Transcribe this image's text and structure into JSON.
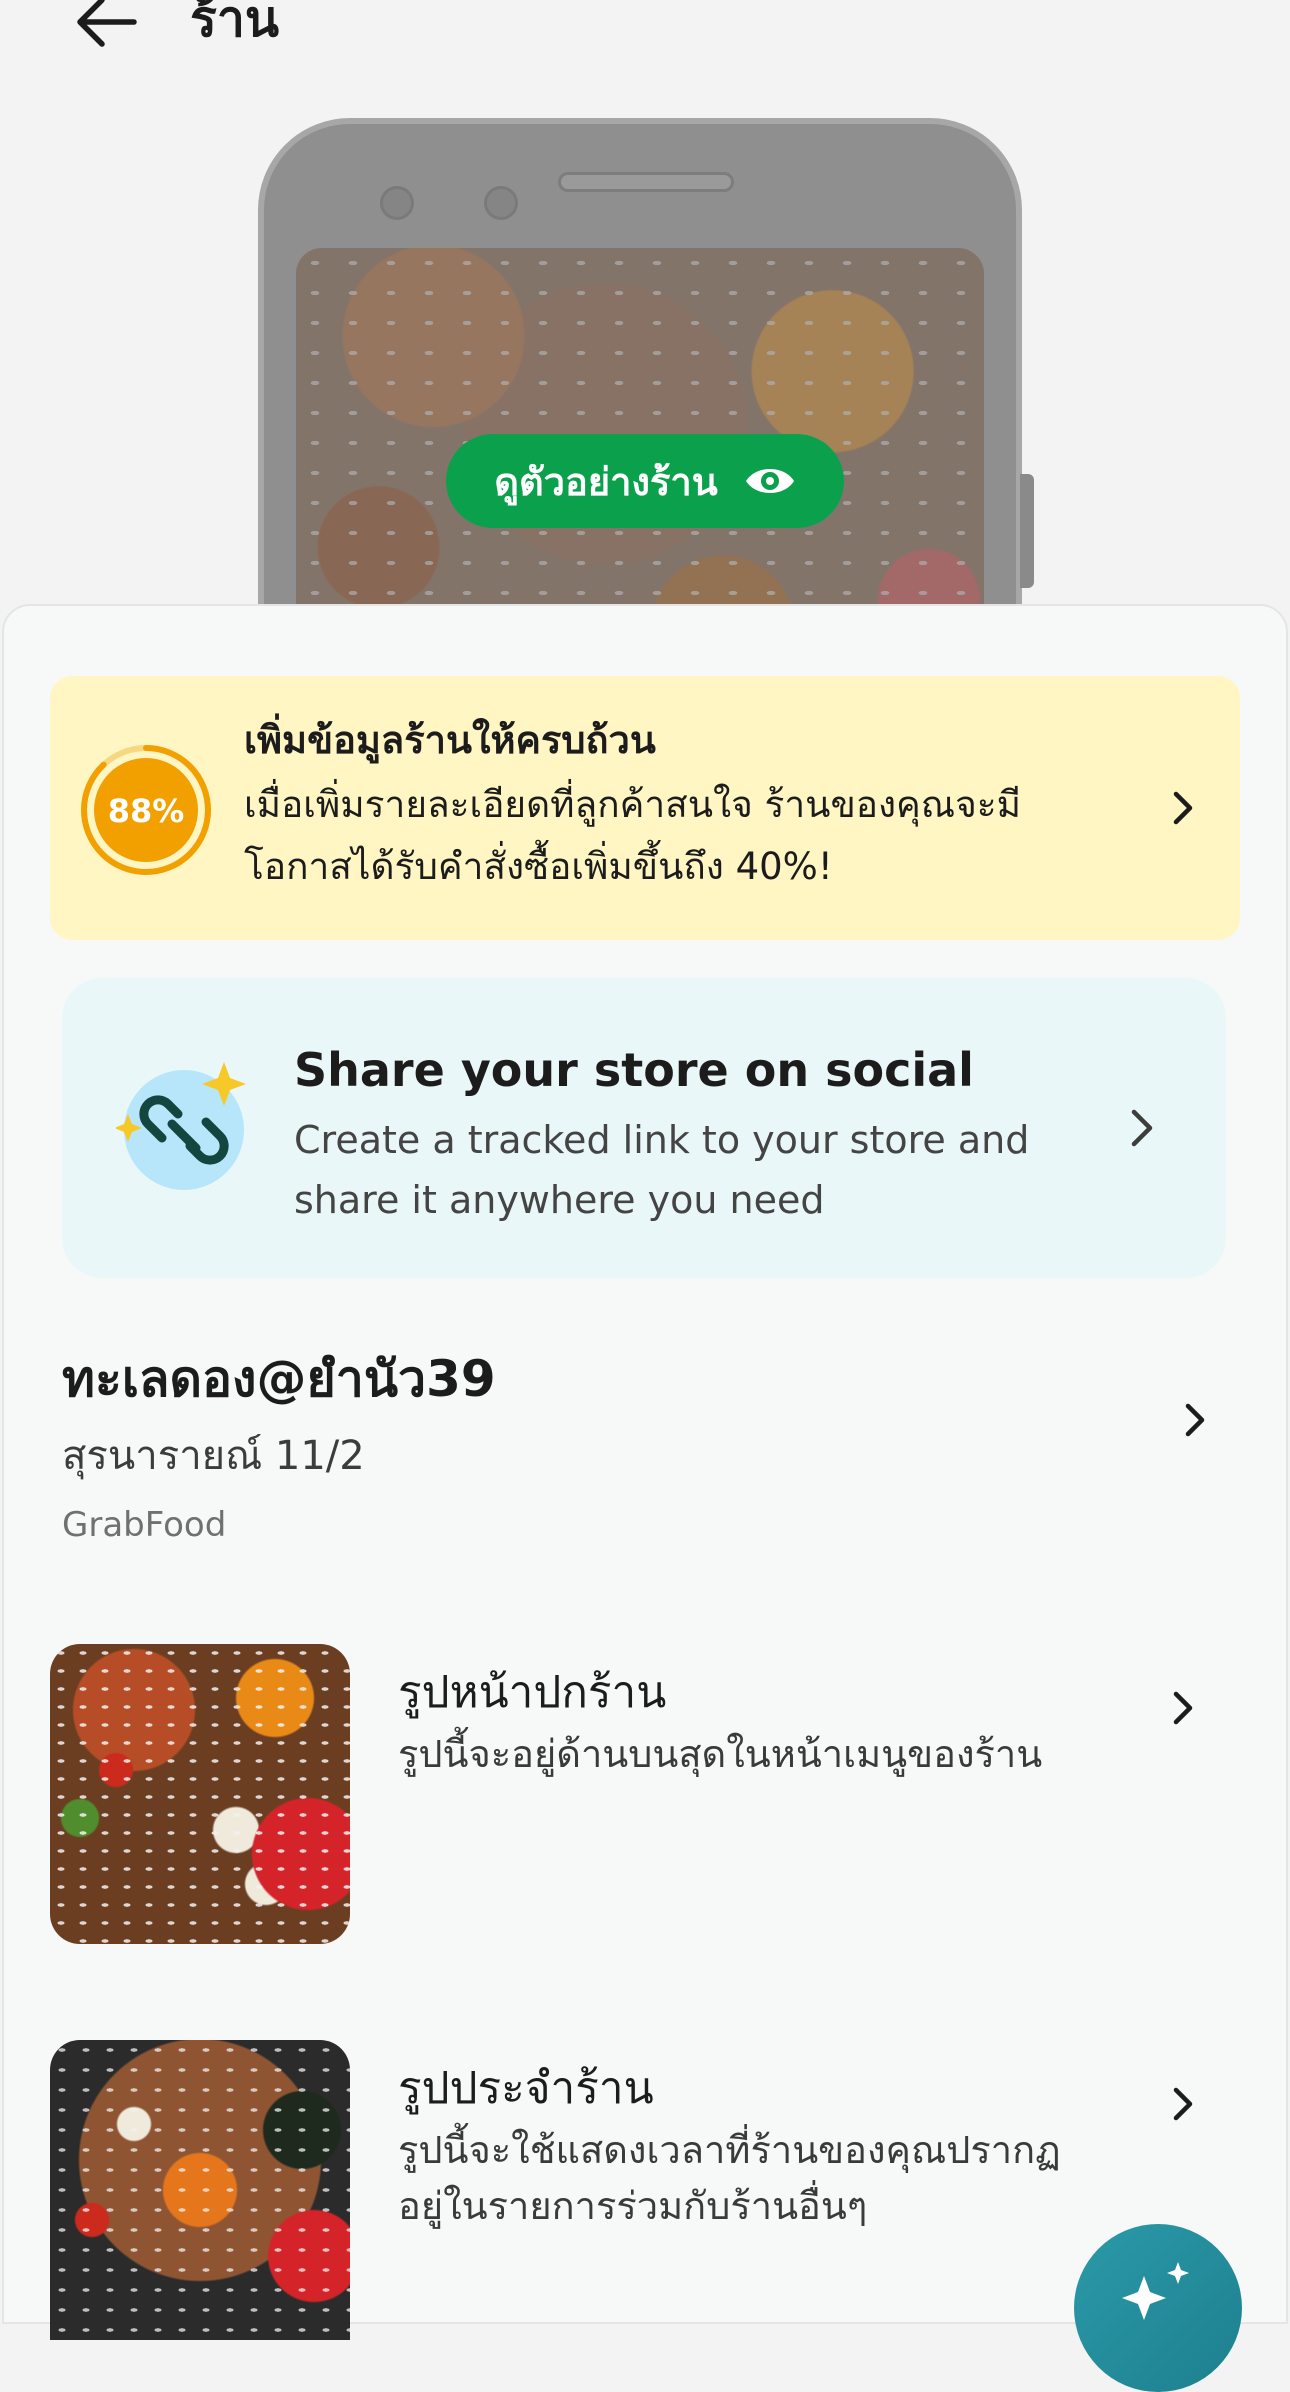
{
  "header": {
    "title": "ร้าน"
  },
  "preview": {
    "button_label": "ดูตัวอย่างร้าน"
  },
  "completion": {
    "percent_label": "88%",
    "percent_value": 0.88,
    "title": "เพิ่มข้อมูลร้านให้ครบถ้วน",
    "desc_line1": "เมื่อเพิ่มรายละเอียดที่ลูกค้าสนใจ ร้านของคุณจะมี",
    "desc_line2": "โอกาสได้รับคำสั่งซื้อเพิ่มขึ้นถึง 40%!"
  },
  "share": {
    "title": "Share your store on social",
    "desc_line1": "Create a tracked link to your store and",
    "desc_line2": "share it anywhere you need"
  },
  "store": {
    "name": "ทะเลดอง@ยำนัว39",
    "address": "สุรนารายณ์ 11/2",
    "platform": "GrabFood"
  },
  "photos": [
    {
      "title": "รูปหน้าปกร้าน",
      "desc_line1": "รูปนี้จะอยู่ด้านบนสุดในหน้าเมนูของร้าน",
      "desc_line2": ""
    },
    {
      "title": "รูปประจำร้าน",
      "desc_line1": "รูปนี้จะใช้แสดงเวลาที่ร้านของคุณปรากฏ",
      "desc_line2": "อยู่ในรายการร่วมกับร้านอื่นๆ"
    }
  ],
  "colors": {
    "brand_green": "#0ba14c",
    "completion_bg": "#fff6c4",
    "progress_orange": "#f2a000",
    "share_bg": "#e9f7f8",
    "fab_teal": "#2b9aa9"
  },
  "icons": {
    "back": "arrow-left-icon",
    "preview": "eye-icon",
    "share": "link-icon",
    "chevron": "chevron-right-icon"
  }
}
